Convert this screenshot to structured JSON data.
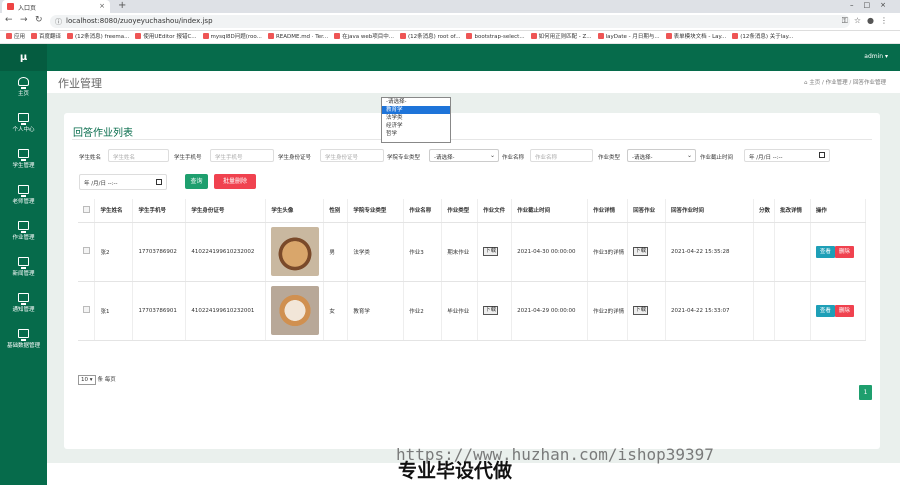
{
  "browser": {
    "tab_title": "入口页",
    "url": "localhost:8080/zuoyeyuchashou/index.jsp",
    "bookmarks": [
      "应用",
      "百度翻译",
      "(12条消息) freema...",
      "使用UEditor 报错C...",
      "mysql8D问题(roo...",
      "README.md · Ter...",
      "在java web项目中...",
      "(12条消息) root of...",
      "bootstrap-select...",
      "如何用正则匹配 - Z...",
      "layDate - 月日期与...",
      "表单模块文档 - Lay...",
      "(12条消息) 关于lay..."
    ]
  },
  "sidebar": {
    "brand": "μ",
    "items": [
      {
        "label": "主页"
      },
      {
        "label": "个人中心"
      },
      {
        "label": "学生管理"
      },
      {
        "label": "老师管理"
      },
      {
        "label": "作业管理"
      },
      {
        "label": "新闻管理"
      },
      {
        "label": "通知管理"
      },
      {
        "label": "基础数据管理"
      }
    ]
  },
  "topnav": {
    "user": "admin ▾"
  },
  "page": {
    "title": "作业管理",
    "breadcrumb": "⌂ 主页 / 作业管理 / 回答作业管理"
  },
  "card": {
    "title": "回答作业列表",
    "filters": {
      "name_label": "学生姓名",
      "name_placeholder": "学生姓名",
      "phone_label": "学生手机号",
      "phone_placeholder": "学生手机号",
      "idcard_label": "学生身份证号",
      "idcard_placeholder": "学生身份证号",
      "major_label": "学院专业类型",
      "major_value": "-请选择-",
      "hwname_label": "作业名称",
      "hwname_placeholder": "作业名称",
      "hwtype_label": "作业类型",
      "hwtype_value": "-请选择-",
      "deadline_label": "作业截止时间",
      "date1": "年 /月/日 --:--",
      "date2": "年 /月/日 --:--"
    },
    "buttons": {
      "search": "查询",
      "batch_delete": "批量删除"
    },
    "dropdown_options": [
      "-请选择-",
      "教育学",
      "法学类",
      "经济学",
      "哲学"
    ],
    "dropdown_selected": 1,
    "table": {
      "headers": [
        "",
        "学生姓名",
        "学生手机号",
        "学生身份证号",
        "学生头像",
        "性别",
        "学院专业类型",
        "作业名称",
        "作业类型",
        "作业文件",
        "作业截止时间",
        "作业详情",
        "回答作业",
        "回答作业时间",
        "分数",
        "批改详情",
        "操作"
      ],
      "rows": [
        {
          "name": "张2",
          "phone": "17703786902",
          "idcard": "410224199610232002",
          "gender": "男",
          "major": "法学类",
          "hwname": "作业3",
          "hwtype": "期末作业",
          "file": "下载",
          "deadline": "2021-04-30 00:00:00",
          "detail": "作业3的详情",
          "answer": "下载",
          "answer_time": "2021-04-22 15:35:28",
          "score": "",
          "review": ""
        },
        {
          "name": "张1",
          "phone": "17703786901",
          "idcard": "410224199610232001",
          "gender": "女",
          "major": "教育学",
          "hwname": "作业2",
          "hwtype": "毕业作业",
          "file": "下载",
          "deadline": "2021-04-29 00:00:00",
          "detail": "作业2的详情",
          "answer": "下载",
          "answer_time": "2021-04-22 15:33:07",
          "score": "",
          "review": ""
        }
      ],
      "view_label": "查看",
      "delete_label": "删除"
    },
    "page_size": "10 ▾",
    "page_size_suffix": "条 每页",
    "current_page": "1"
  },
  "watermark": {
    "url": "https://www.huzhan.com/ishop39397",
    "text": "专业毕设代做"
  }
}
